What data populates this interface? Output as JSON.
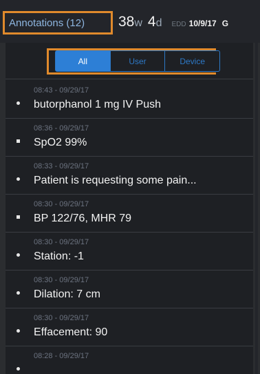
{
  "header": {
    "annotations_label": "Annotations (12)",
    "ga_weeks": "38",
    "ga_weeks_unit": "w",
    "ga_days": "4",
    "ga_days_unit": "d",
    "edd_label": "EDD",
    "edd_value": "10/9/17",
    "trailing": "G"
  },
  "filter": {
    "tabs": [
      "All",
      "User",
      "Device"
    ],
    "selected": "All"
  },
  "annotations": [
    {
      "time": "08:43 - 09/29/17",
      "text": "butorphanol 1 mg IV Push",
      "marker": "dot"
    },
    {
      "time": "08:36 - 09/29/17",
      "text": "SpO2  99%",
      "marker": "square"
    },
    {
      "time": "08:33 - 09/29/17",
      "text": "Patient is requesting some pain...",
      "marker": "dot"
    },
    {
      "time": "08:30 - 09/29/17",
      "text": "BP  122/76, MHR  79",
      "marker": "square"
    },
    {
      "time": "08:30 - 09/29/17",
      "text": "Station: -1",
      "marker": "dot"
    },
    {
      "time": "08:30 - 09/29/17",
      "text": "Dilation: 7 cm",
      "marker": "dot"
    },
    {
      "time": "08:30 - 09/29/17",
      "text": "Effacement: 90",
      "marker": "dot"
    },
    {
      "time": "08:28 - 09/29/17",
      "text": "",
      "marker": "dot"
    }
  ],
  "colors": {
    "accent": "#2d7fd6",
    "highlight": "#e08a2c",
    "background": "#1e2024"
  }
}
